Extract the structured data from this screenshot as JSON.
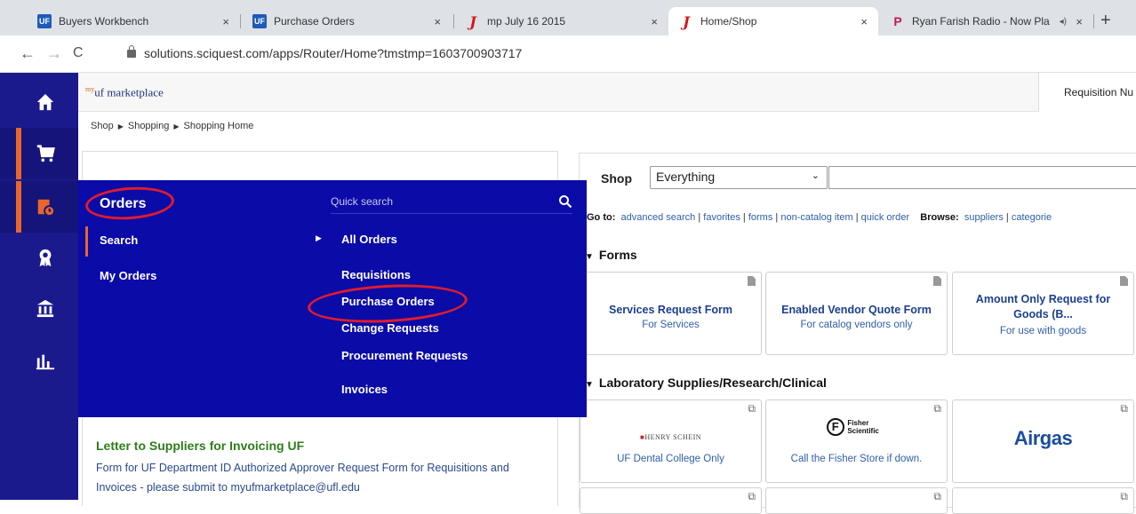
{
  "browser": {
    "tabs": [
      {
        "title": "Buyers Workbench",
        "favicon": "uf-favicon"
      },
      {
        "title": "Purchase Orders",
        "favicon": "uf-favicon"
      },
      {
        "title": "mp July 16 2015",
        "favicon": "j-favicon"
      },
      {
        "title": "Home/Shop",
        "favicon": "j-favicon"
      },
      {
        "title": "Ryan Farish Radio - Now Pla",
        "favicon": "pandora-favicon"
      }
    ],
    "close_glyph": "×",
    "new_tab_glyph": "+",
    "url": "solutions.sciquest.com/apps/Router/Home?tmstmp=1603700903717"
  },
  "header": {
    "logo_prefix": "my",
    "logo_text": "uf marketplace",
    "requisition_label": "Requisition Nu"
  },
  "breadcrumb": [
    "Shop",
    "Shopping",
    "Shopping Home"
  ],
  "left_nav": [
    "home-icon",
    "cart-icon",
    "orders-icon",
    "award-icon",
    "bank-icon",
    "reports-icon"
  ],
  "orders_menu": {
    "title": "Orders",
    "left_items": [
      "Search",
      "My Orders"
    ],
    "search_placeholder": "Quick search",
    "right_items": [
      "All Orders",
      "Requisitions",
      "Purchase Orders",
      "Change Requests",
      "Procurement Requests",
      "Invoices"
    ]
  },
  "letter": {
    "title": "Letter to Suppliers for Invoicing UF",
    "body": "Form for UF Department ID Authorized Approver Request Form for Requisitions and Invoices - please submit to myufmarketplace@ufl.edu"
  },
  "shop": {
    "label": "Shop",
    "scope": "Everything",
    "goto_label": "Go to:",
    "goto_links": [
      "advanced search",
      "favorites",
      "forms",
      "non-catalog item",
      "quick order"
    ],
    "browse_label": "Browse:",
    "browse_links": [
      "suppliers",
      "categorie"
    ],
    "forms_title": "Forms",
    "forms": [
      {
        "title": "Services Request Form",
        "subtitle": "For Services"
      },
      {
        "title": "Enabled Vendor Quote Form",
        "subtitle": "For catalog vendors only"
      },
      {
        "title": "Amount Only Request for Goods (B...",
        "subtitle": "For use with goods"
      }
    ],
    "lab_title": "Laboratory Supplies/Research/Clinical",
    "lab_vendors": [
      {
        "logo": "HENRY SCHEIN",
        "subtitle": "UF Dental College Only"
      },
      {
        "logo": "Fisher Scientific",
        "subtitle": "Call the Fisher Store if down."
      },
      {
        "logo": "Airgas",
        "subtitle": ""
      }
    ]
  },
  "colors": {
    "nav_bg": "#1a1a8c",
    "menu_bg": "#0b0ba8",
    "accent_orange": "#e8652c",
    "annotation_red": "#e21b2b",
    "link_blue": "#2f5fa8",
    "letter_green": "#2e7d1a"
  }
}
